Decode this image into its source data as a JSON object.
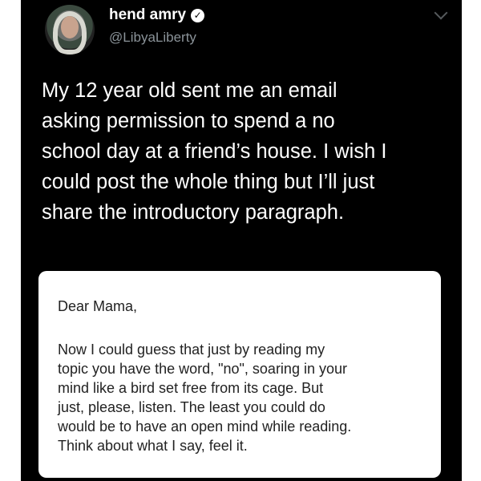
{
  "author": {
    "display_name": "hend amry",
    "handle": "@LibyaLiberty",
    "verified_icon": "verified-badge-icon"
  },
  "tweet": {
    "lines": [
      "My 12 year old sent me an email",
      "asking permission to spend a no",
      "school day at a friend’s house. I wish I",
      "could post the whole thing but I’ll just",
      "share the introductory paragraph."
    ]
  },
  "email": {
    "greeting": "Dear Mama,",
    "lines": [
      "Now I could guess that just by reading my",
      "topic you have the word, \"no\", soaring in your",
      "mind like a bird set free from its cage. But",
      "just, please, listen. The least you could do",
      "would be to have an open mind while reading.",
      "Think about what I say, feel it."
    ]
  },
  "colors": {
    "background": "#000000",
    "text": "#ffffff",
    "handle": "#8b9399",
    "card": "#ffffff"
  }
}
